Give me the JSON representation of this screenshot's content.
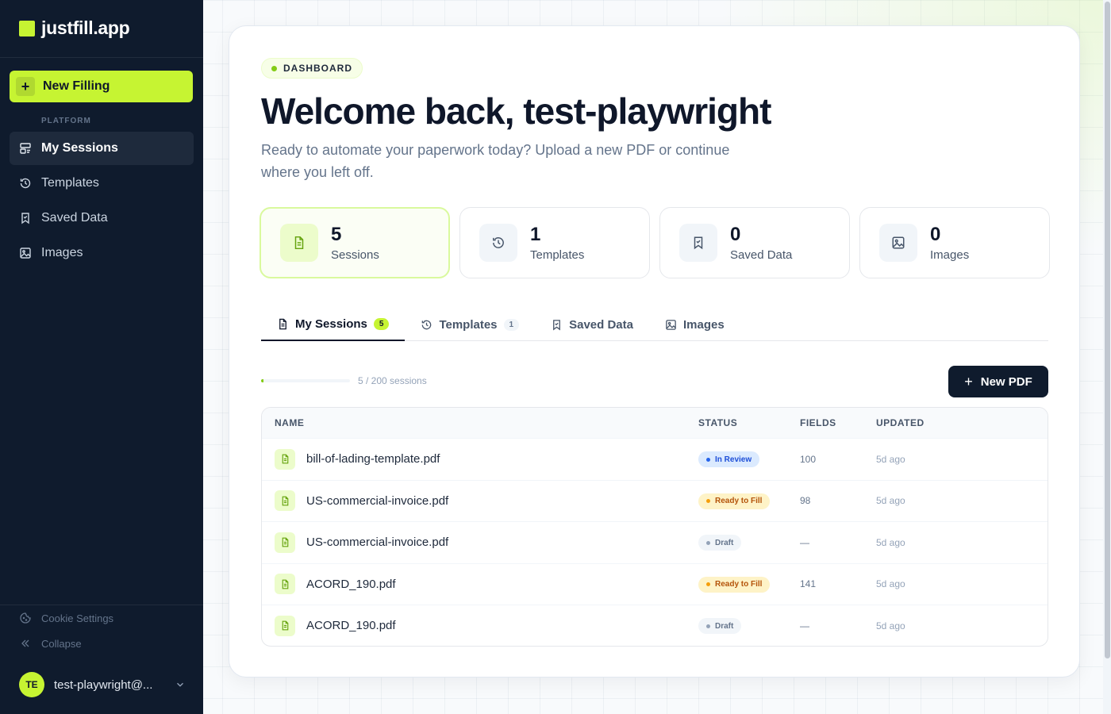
{
  "app": {
    "logo_text": "justfill.app"
  },
  "sidebar": {
    "new_filling_label": "New Filling",
    "section_label": "PLATFORM",
    "items": [
      {
        "label": "My Sessions",
        "icon": "sessions-icon",
        "active": true
      },
      {
        "label": "Templates",
        "icon": "history-icon"
      },
      {
        "label": "Saved Data",
        "icon": "bookmark-icon"
      },
      {
        "label": "Images",
        "icon": "image-icon"
      }
    ],
    "cookie_label": "Cookie Settings",
    "collapse_label": "Collapse",
    "user": {
      "initials": "TE",
      "name": "test-playwright@..."
    }
  },
  "main": {
    "badge": "DASHBOARD",
    "title": "Welcome back, test-playwright",
    "subtitle": "Ready to automate your paperwork today? Upload a new PDF or continue where you left off.",
    "stats": [
      {
        "value": "5",
        "label": "Sessions",
        "icon": "document-icon",
        "active": true
      },
      {
        "value": "1",
        "label": "Templates",
        "icon": "history-icon"
      },
      {
        "value": "0",
        "label": "Saved Data",
        "icon": "bookmark-icon"
      },
      {
        "value": "0",
        "label": "Images",
        "icon": "image-icon"
      }
    ],
    "tabs": [
      {
        "label": "My Sessions",
        "count": "5",
        "icon": "document-icon",
        "active": true
      },
      {
        "label": "Templates",
        "count": "1",
        "icon": "history-icon"
      },
      {
        "label": "Saved Data",
        "count": "",
        "icon": "bookmark-icon"
      },
      {
        "label": "Images",
        "count": "",
        "icon": "image-icon"
      }
    ],
    "usage": {
      "text": "5 / 200 sessions",
      "fraction": 0.025
    },
    "new_pdf_label": "New PDF",
    "table": {
      "headers": [
        "NAME",
        "STATUS",
        "FIELDS",
        "UPDATED"
      ],
      "rows": [
        {
          "name": "bill-of-lading-template.pdf",
          "status": "In Review",
          "status_kind": "review",
          "fields": "100",
          "updated": "5d ago"
        },
        {
          "name": "US-commercial-invoice.pdf",
          "status": "Ready to Fill",
          "status_kind": "ready",
          "fields": "98",
          "updated": "5d ago"
        },
        {
          "name": "US-commercial-invoice.pdf",
          "status": "Draft",
          "status_kind": "draft",
          "fields": "—",
          "updated": "5d ago"
        },
        {
          "name": "ACORD_190.pdf",
          "status": "Ready to Fill",
          "status_kind": "ready",
          "fields": "141",
          "updated": "5d ago"
        },
        {
          "name": "ACORD_190.pdf",
          "status": "Draft",
          "status_kind": "draft",
          "fields": "—",
          "updated": "5d ago"
        }
      ]
    }
  },
  "colors": {
    "accent": "#c6f432",
    "sidebar_bg": "#0f1b2d",
    "review_bg": "#dbeafe",
    "review_fg": "#1d4ed8",
    "ready_bg": "#fef3c7",
    "ready_fg": "#b45309",
    "draft_bg": "#f1f5f9",
    "draft_fg": "#64748b"
  }
}
